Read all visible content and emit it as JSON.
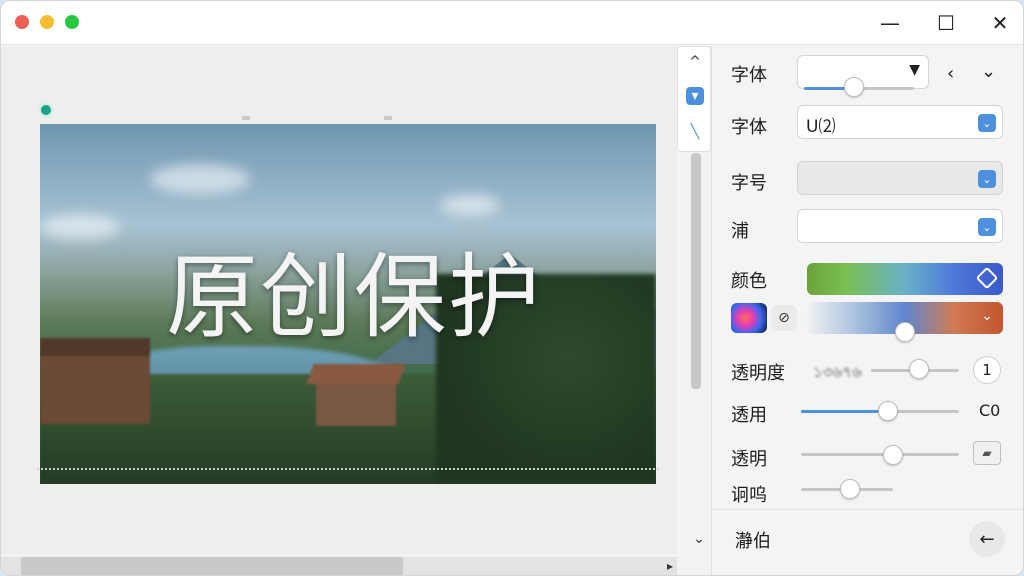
{
  "window": {
    "controls": {
      "minimize": "—",
      "maximize": "☐",
      "close": "✕"
    }
  },
  "canvas": {
    "image_title": "原创保护"
  },
  "mini_toolbar": {
    "up": "^",
    "tool1": "▾",
    "tool2": "╲"
  },
  "scroll": {
    "down": "⌄",
    "right": "▸"
  },
  "panel": {
    "font_label_1": "字体",
    "font_label_2": "字体",
    "font_value_2": "U⑵",
    "size_label": "字号",
    "p_label": "浦",
    "color_label": "颜色",
    "opacity_label": "透明度",
    "opacity_blur_text": "১৩৬৭৬",
    "opacity_value": "1",
    "use_label": "透用",
    "use_value": "C0",
    "transparent_label": "透明",
    "adjust_label": "诇呜",
    "footer_label": "瀞伯",
    "nav_prev": "‹",
    "nav_next": "⌄",
    "chev": "⌄",
    "eyedrop": "⊘"
  },
  "sliders": {
    "font_1": 0.45,
    "opacity": 0.55,
    "use": 0.55,
    "transparent": 0.58,
    "adjust": 0.53,
    "gradient_2": 0.5
  },
  "colors": {
    "accent": "#4d90dd",
    "rotate_handle": "#1aa389"
  }
}
